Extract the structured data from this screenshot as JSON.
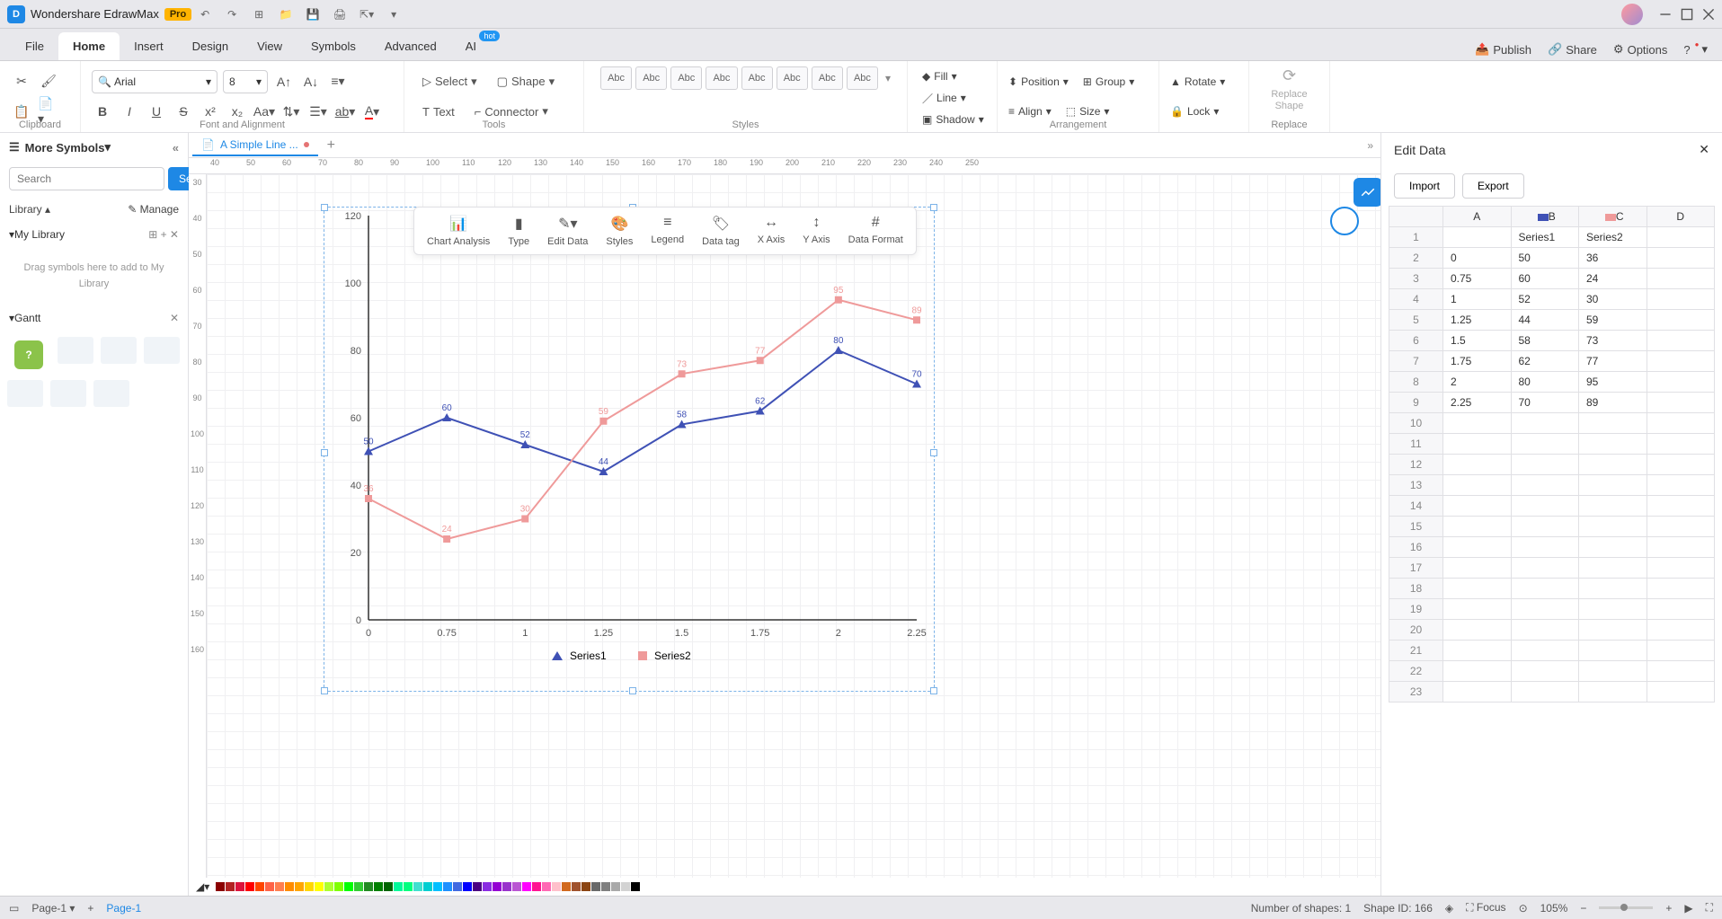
{
  "app": {
    "title": "Wondershare EdrawMax",
    "pro": "Pro"
  },
  "menus": [
    "File",
    "Home",
    "Insert",
    "Design",
    "View",
    "Symbols",
    "Advanced",
    "AI"
  ],
  "active_menu": "Home",
  "rightMenu": {
    "publish": "Publish",
    "share": "Share",
    "options": "Options"
  },
  "ribbon": {
    "clipboard": "Clipboard",
    "fontAlign": "Font and Alignment",
    "tools": "Tools",
    "styles": "Styles",
    "arrangement": "Arrangement",
    "replace": "Replace",
    "font": "Arial",
    "size": "8",
    "select": "Select",
    "shape": "Shape",
    "text": "Text",
    "connector": "Connector",
    "fill": "Fill",
    "line": "Line",
    "shadow": "Shadow",
    "position": "Position",
    "align": "Align",
    "group": "Group",
    "sizeBtn": "Size",
    "rotate": "Rotate",
    "lock": "Lock",
    "replaceShape": "Replace Shape",
    "abc": "Abc"
  },
  "left": {
    "more": "More Symbols",
    "searchPh": "Search",
    "search": "Search",
    "library": "Library",
    "manage": "Manage",
    "mylib": "My Library",
    "drop": "Drag symbols here to add to My Library",
    "gantt": "Gantt"
  },
  "tab": "A Simple Line ...",
  "chartToolbar": [
    "Chart Analysis",
    "Type",
    "Edit Data",
    "Styles",
    "Legend",
    "Data tag",
    "X Axis",
    "Y Axis",
    "Data Format"
  ],
  "rightPanel": {
    "title": "Edit Data",
    "import": "Import",
    "export": "Export",
    "cols": [
      "",
      "A",
      "B",
      "C",
      "D"
    ],
    "s1": "Series1",
    "s2": "Series2"
  },
  "status": {
    "page": "Page-1",
    "pagesel": "Page-1",
    "shapes": "Number of shapes: 1",
    "shapeId": "Shape ID: 166",
    "focus": "Focus",
    "zoom": "105%"
  },
  "rulerH": [
    "40",
    "50",
    "60",
    "70",
    "80",
    "90",
    "100",
    "110",
    "120",
    "130",
    "140",
    "150",
    "160",
    "170",
    "180",
    "190",
    "200",
    "210",
    "220",
    "230",
    "240",
    "250"
  ],
  "rulerV": [
    "30",
    "40",
    "50",
    "60",
    "70",
    "80",
    "90",
    "100",
    "110",
    "120",
    "130",
    "140",
    "150",
    "160"
  ],
  "chart_data": {
    "type": "line",
    "categories": [
      "0",
      "0.75",
      "1",
      "1.25",
      "1.5",
      "1.75",
      "2",
      "2.25"
    ],
    "series": [
      {
        "name": "Series1",
        "color": "#3f51b5",
        "values": [
          50,
          60,
          52,
          44,
          58,
          62,
          80,
          70
        ]
      },
      {
        "name": "Series2",
        "color": "#ef9a9a",
        "values": [
          36,
          24,
          30,
          59,
          73,
          77,
          95,
          89
        ]
      }
    ],
    "ylim": [
      0,
      120
    ],
    "ystep": 20,
    "ylabel": "",
    "xlabel": ""
  },
  "tableRows": [
    [
      "",
      "Series1",
      "Series2",
      ""
    ],
    [
      "0",
      "50",
      "36",
      ""
    ],
    [
      "0.75",
      "60",
      "24",
      ""
    ],
    [
      "1",
      "52",
      "30",
      ""
    ],
    [
      "1.25",
      "44",
      "59",
      ""
    ],
    [
      "1.5",
      "58",
      "73",
      ""
    ],
    [
      "1.75",
      "62",
      "77",
      ""
    ],
    [
      "2",
      "80",
      "95",
      ""
    ],
    [
      "2.25",
      "70",
      "89",
      ""
    ]
  ],
  "colors": [
    "#8b0000",
    "#b22222",
    "#dc143c",
    "#ff0000",
    "#ff4500",
    "#ff6347",
    "#ff7f50",
    "#ff8c00",
    "#ffa500",
    "#ffd700",
    "#ffff00",
    "#adff2f",
    "#7fff00",
    "#00ff00",
    "#32cd32",
    "#228b22",
    "#008000",
    "#006400",
    "#00fa9a",
    "#00ff7f",
    "#40e0d0",
    "#00ced1",
    "#00bfff",
    "#1e90ff",
    "#4169e1",
    "#0000ff",
    "#4b0082",
    "#8a2be2",
    "#9400d3",
    "#9932cc",
    "#ba55d3",
    "#ff00ff",
    "#ff1493",
    "#ff69b4",
    "#ffc0cb",
    "#d2691e",
    "#a0522d",
    "#8b4513",
    "#696969",
    "#808080",
    "#a9a9a9",
    "#d3d3d3",
    "#000000",
    "#ffffff"
  ]
}
